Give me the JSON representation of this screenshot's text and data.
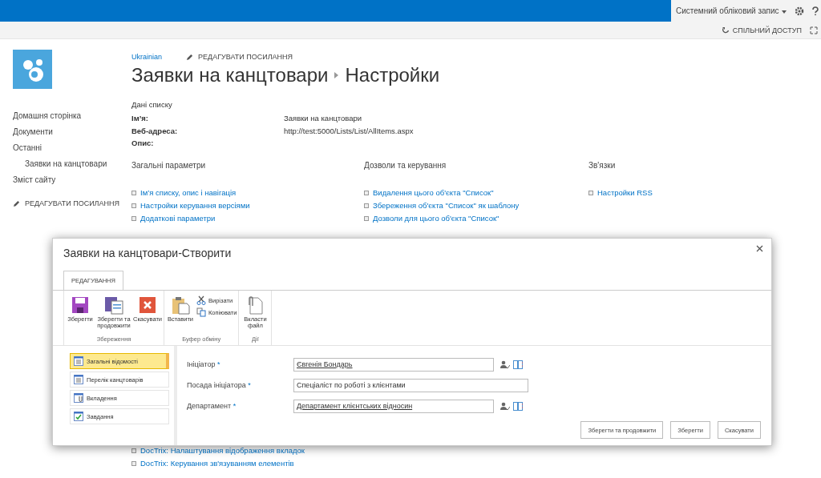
{
  "top_bar": {
    "account": "Системний обліковий запис",
    "share": "СПІЛЬНИЙ ДОСТУП"
  },
  "header": {
    "language_link": "Ukrainian",
    "edit_links": "РЕДАГУВАТИ ПОСИЛАННЯ",
    "breadcrumb": [
      "Заявки на канцтовари",
      "Настройки"
    ]
  },
  "quick_launch": {
    "items": [
      {
        "label": "Домашня сторінка"
      },
      {
        "label": "Документи"
      },
      {
        "label": "Останні",
        "children": [
          {
            "label": "Заявки на канцтовари"
          }
        ]
      },
      {
        "label": "Зміст сайту"
      }
    ],
    "edit_links": "РЕДАГУВАТИ ПОСИЛАННЯ"
  },
  "list_info": {
    "heading": "Дані списку",
    "fields": [
      {
        "label": "Ім’я:",
        "value": "Заявки на канцтовари"
      },
      {
        "label": "Веб-адреса:",
        "value": "http://test:5000/Lists/List/AllItems.aspx"
      },
      {
        "label": "Опис:"
      }
    ]
  },
  "sections": [
    {
      "title": "Загальні параметри",
      "links": [
        "Ім’я списку, опис і навігація",
        "Настройки керування версіями",
        "Додаткові параметри"
      ],
      "links_below_dialog": [
        "DocTrix: Налаштування відображення вкладок",
        "DocTrix: Керування зв'язуванням елементів"
      ]
    },
    {
      "title": "Дозволи та керування",
      "links": [
        "Видалення цього об'єкта \"Список\"",
        "Збереження об'єкта \"Список\" як шаблону",
        "Дозволи для цього об'єкта \"Список\""
      ]
    },
    {
      "title": "Зв'язки",
      "links": [
        "Настройки RSS"
      ]
    }
  ],
  "dialog": {
    "title": "Заявки на канцтовари-Створити",
    "ribbon": {
      "tabs": [
        {
          "label": "РЕДАГУВАННЯ",
          "selected": true
        }
      ],
      "groups": [
        {
          "label": "Збереження",
          "buttons": [
            {
              "label": "Зберегти",
              "kind": "save"
            },
            {
              "label": "Зберегти та продовжити",
              "kind": "save-continue"
            },
            {
              "label": "Скасувати",
              "kind": "cancel"
            }
          ]
        },
        {
          "label": "Буфер обміну",
          "buttons": [
            {
              "label": "Вставити",
              "kind": "paste"
            },
            {
              "label": "Вирізати",
              "kind": "cut"
            },
            {
              "label": "Копіювати",
              "kind": "copy"
            }
          ]
        },
        {
          "label": "Дії",
          "buttons": [
            {
              "label": "Вкласти файл",
              "kind": "attach"
            }
          ]
        }
      ]
    },
    "nav": [
      {
        "label": "Загальні відомості",
        "kind": "form",
        "selected": true
      },
      {
        "label": "Перелік канцтоварів",
        "kind": "list",
        "selected": false
      },
      {
        "label": "Вкладення",
        "kind": "attachment",
        "selected": false
      },
      {
        "label": "Завдання",
        "kind": "task",
        "selected": false
      }
    ],
    "fields": [
      {
        "label": "Ініціатор",
        "required_mark": "*",
        "value": "Євгенія Бондарь",
        "kind": "lookup"
      },
      {
        "label": "Посада ініціатора",
        "required_mark": "*",
        "value": "Спеціаліст по роботі з клієнтами",
        "kind": "text"
      },
      {
        "label": "Департамент",
        "required_mark": "*",
        "value": "Департамент клієнтських відносин",
        "kind": "lookup"
      }
    ],
    "buttons": [
      "Зберегти та продовжити",
      "Зберегти",
      "Скасувати"
    ]
  }
}
